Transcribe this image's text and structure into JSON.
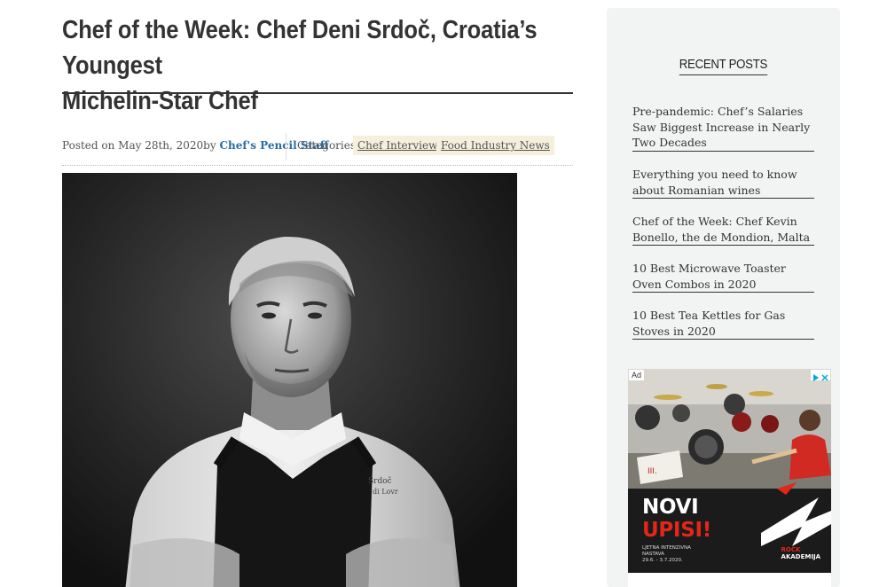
{
  "article": {
    "title_line1": "Chef of the Week: Chef Deni Srdoč, Croatia’s Youngest",
    "title_line2": "Michelin-Star Chef",
    "meta": {
      "posted_prefix": "Posted on May 28th, 2020by",
      "author": "Chef's Pencil Staff",
      "categories_label": "Categories:",
      "categories": [
        "Chef Interviews",
        "Food Industry News"
      ]
    },
    "hero_image": "black-and-white portrait of chef in white jacket and dark apron"
  },
  "sidebar": {
    "widget_title": "RECENT POSTS",
    "recent_posts": [
      "Pre-pandemic: Chef’s Salaries Saw Biggest Increase in Nearly Two Decades",
      "Everything you need to know about Romanian wines",
      "Chef of the Week: Chef Kevin Bonello, the de Mondion, Malta",
      "10 Best Microwave Toaster Oven Combos in 2020",
      "10 Best Tea Kettles for Gas Stoves in 2020"
    ],
    "ad": {
      "label": "Ad",
      "headline_line1": "NOVI",
      "headline_line2": "UPISI!",
      "sub_line1": "LJETNA INTENZIVNA",
      "sub_line2": "NASTAVA",
      "sub_line3": "29.6. - 3.7.2020.",
      "brand_prefix": "ROCK",
      "brand": "AKADEMIJA"
    }
  },
  "colors": {
    "author_link": "#2a6d9e",
    "category_tag_bg": "#f6efdc",
    "sidebar_bg": "#f2f4f4",
    "ad_accent": "#e2261a"
  }
}
